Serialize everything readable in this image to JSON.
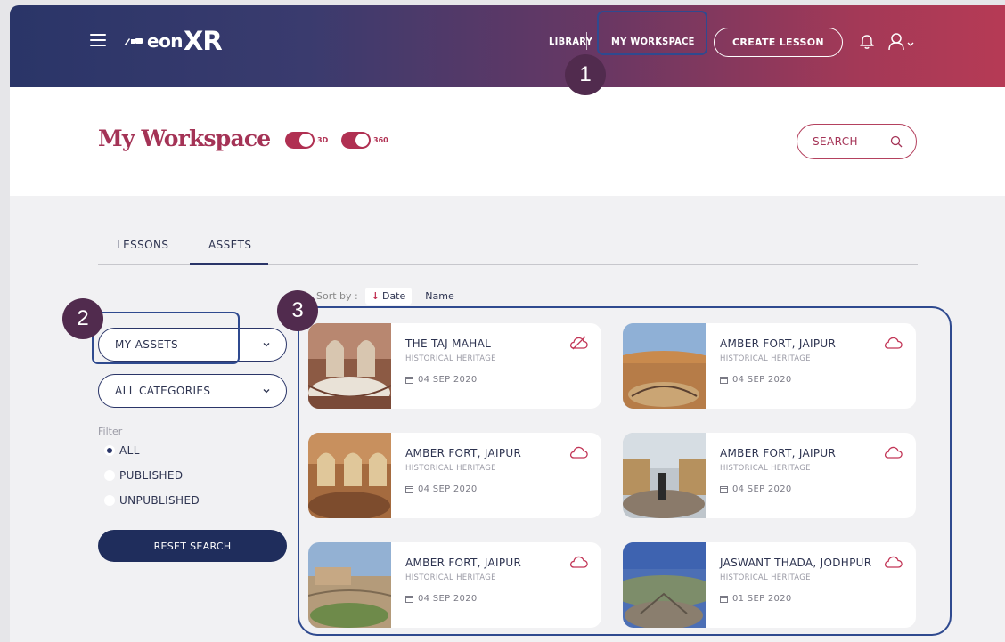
{
  "header": {
    "logo_eon": "eon",
    "logo_xr": "XR",
    "nav": {
      "library": "LIBRARY",
      "my_workspace": "MY WORKSPACE"
    },
    "create_lesson": "CREATE LESSON"
  },
  "page": {
    "title": "My Workspace",
    "toggle_3d": "3D",
    "toggle_360": "360",
    "search_placeholder": "SEARCH"
  },
  "tabs": [
    {
      "label": "LESSONS",
      "active": false
    },
    {
      "label": "ASSETS",
      "active": true
    }
  ],
  "sort": {
    "label": "Sort by :",
    "options": [
      "Date",
      "Name"
    ],
    "selected": "Date"
  },
  "filters": {
    "owner_dropdown": "MY ASSETS",
    "category_dropdown": "ALL CATEGORIES",
    "filter_label": "Filter",
    "radios": [
      {
        "label": "ALL",
        "selected": true
      },
      {
        "label": "PUBLISHED",
        "selected": false
      },
      {
        "label": "UNPUBLISHED",
        "selected": false
      }
    ],
    "reset_button": "RESET SEARCH"
  },
  "assets": [
    {
      "title": "THE TAJ MAHAL",
      "category": "HISTORICAL HERITAGE",
      "date": "04 SEP 2020",
      "icon": "cloud-off-icon"
    },
    {
      "title": "AMBER FORT, JAIPUR",
      "category": "HISTORICAL HERITAGE",
      "date": "04 SEP 2020",
      "icon": "cloud-icon"
    },
    {
      "title": "AMBER FORT, JAIPUR",
      "category": "HISTORICAL HERITAGE",
      "date": "04 SEP 2020",
      "icon": "cloud-icon"
    },
    {
      "title": "AMBER FORT, JAIPUR",
      "category": "HISTORICAL HERITAGE",
      "date": "04 SEP 2020",
      "icon": "cloud-icon"
    },
    {
      "title": "AMBER FORT, JAIPUR",
      "category": "HISTORICAL HERITAGE",
      "date": "04 SEP 2020",
      "icon": "cloud-icon"
    },
    {
      "title": "JASWANT THADA, JODHPUR",
      "category": "HISTORICAL HERITAGE",
      "date": "01 SEP 2020",
      "icon": "cloud-icon"
    }
  ],
  "callouts": [
    "1",
    "2",
    "3"
  ],
  "colors": {
    "accent": "#b03052",
    "navy": "#1f2d5c",
    "callout": "#512b4e"
  }
}
